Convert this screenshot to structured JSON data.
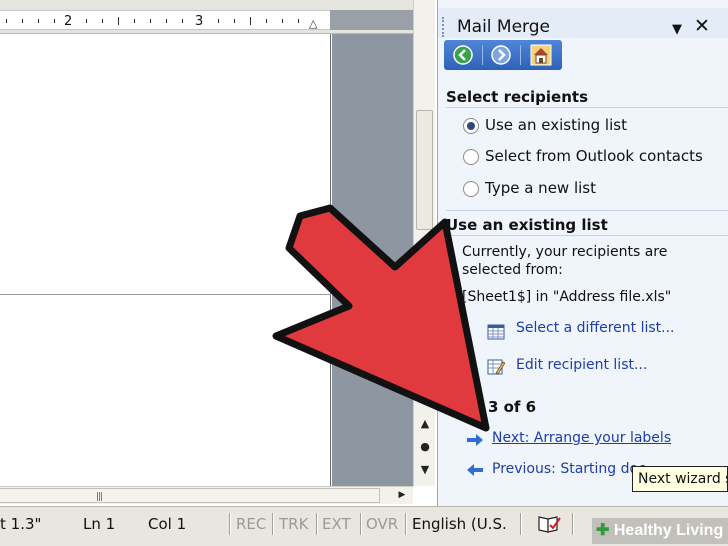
{
  "ruler": {
    "numbers": [
      "2",
      "3"
    ]
  },
  "task_pane": {
    "title": "Mail Merge",
    "menu_glyph": "▼",
    "close_glyph": "✕",
    "toolbar": {
      "back_icon": "back-icon",
      "forward_icon": "forward-icon",
      "home_icon": "home-icon"
    },
    "select_recipients": {
      "heading": "Select recipients",
      "options": [
        {
          "label": "Use an existing list",
          "checked": true
        },
        {
          "label": "Select from Outlook contacts",
          "checked": false
        },
        {
          "label": "Type a new list",
          "checked": false
        }
      ]
    },
    "existing_list": {
      "heading": "Use an existing list",
      "line1": "Currently, your recipients are",
      "line2": "selected from:",
      "source": "[Sheet1$] in \"Address file.xls\"",
      "select_link": "Select a different list...",
      "edit_link": "Edit recipient list..."
    },
    "step": {
      "label": "p 3 of 6",
      "next_link": "Next: Arrange your labels",
      "previous_link": "Previous: Starting doc"
    }
  },
  "tooltip": "Next wizard s",
  "status_bar": {
    "position": "t 1.3\"",
    "line": "Ln 1",
    "column": "Col 1",
    "rec": "REC",
    "trk": "TRK",
    "ext": "EXT",
    "ovr": "OVR",
    "language": "English (U.S.",
    "spelling_icon": "book-check-icon"
  },
  "watermark": "Healthy Living",
  "colors": {
    "arrow_fill": "#e03a3e",
    "arrow_stroke": "#111111",
    "link": "#1d3ea8",
    "pane_bg": "#f0f4fb",
    "toolbar_blue": "#3a6cc4"
  }
}
